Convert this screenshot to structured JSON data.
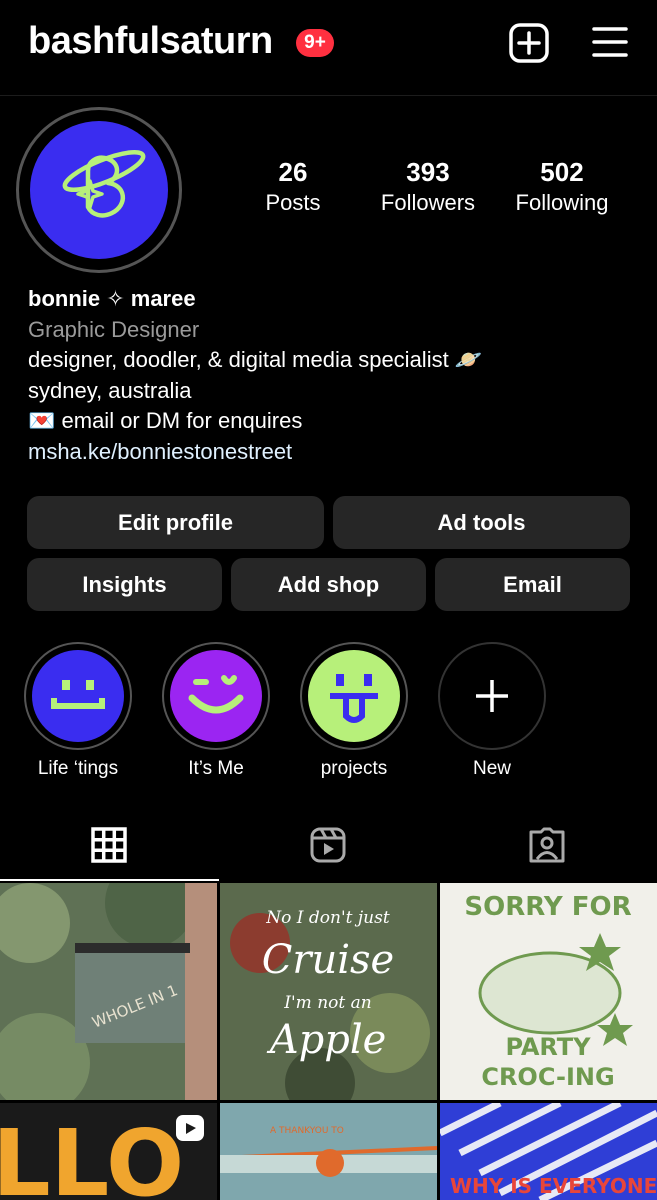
{
  "header": {
    "username": "bashfulsaturn",
    "notification_badge": "9+",
    "create_icon": "plus-square-icon",
    "menu_icon": "hamburger-menu-icon"
  },
  "stats": [
    {
      "value": "26",
      "label": "Posts"
    },
    {
      "value": "393",
      "label": "Followers"
    },
    {
      "value": "502",
      "label": "Following"
    }
  ],
  "profile": {
    "display_name": "bonnie ✧ maree",
    "category": "Graphic Designer",
    "bio_line1": "designer, doodler, & digital media specialist 🪐",
    "bio_line2": "sydney, australia",
    "bio_line3": "💌 email or DM for enquires",
    "link": "msha.ke/bonniestonestreet",
    "avatar_color": "#3a2df0",
    "avatar_accent": "#b7f07a"
  },
  "buttons": {
    "edit_profile": "Edit profile",
    "ad_tools": "Ad tools",
    "insights": "Insights",
    "add_shop": "Add shop",
    "email": "Email"
  },
  "highlights": [
    {
      "label": "Life ‘tings",
      "color": "#3a2df0",
      "face": "#b7f07a"
    },
    {
      "label": "It’s Me",
      "color": "#9b25f2",
      "face": "#b7f07a"
    },
    {
      "label": "projects",
      "color": "#b7f07a",
      "face": "#3a2df0"
    },
    {
      "label": "New",
      "color": "#000000",
      "face": "#ffffff"
    }
  ],
  "tabs": [
    {
      "name": "grid",
      "icon": "grid-icon",
      "active": true
    },
    {
      "name": "reels",
      "icon": "reels-icon",
      "active": false
    },
    {
      "name": "tagged",
      "icon": "tagged-person-icon",
      "active": false
    }
  ],
  "posts": [
    {
      "title": "WHOLE IN 1"
    },
    {
      "title": "No I don't just Cruise I'm not an Apple"
    },
    {
      "title": "SORRY FOR PARTY CROC-ING"
    },
    {
      "title": "LLO"
    },
    {
      "title": "A THANKYOU TO"
    },
    {
      "title": "WHY IS EVERYONE"
    }
  ]
}
